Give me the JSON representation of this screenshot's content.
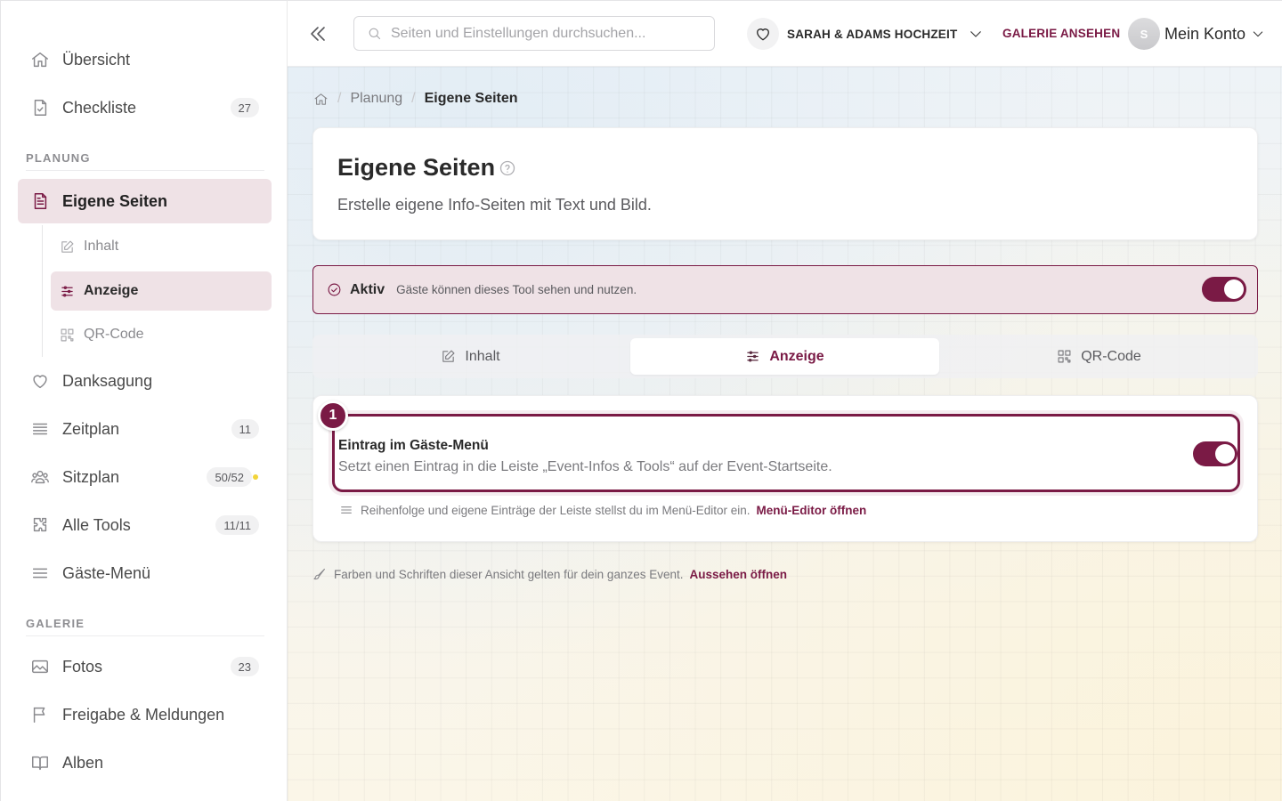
{
  "sidebar": {
    "items_top": [
      {
        "label": "Übersicht"
      },
      {
        "label": "Checkliste",
        "badge": "27"
      }
    ],
    "section_planung": "PLANUNG",
    "active_item": {
      "label": "Eigene Seiten"
    },
    "sub_items": [
      {
        "label": "Inhalt"
      },
      {
        "label": "Anzeige"
      },
      {
        "label": "QR-Code"
      }
    ],
    "items_planung": [
      {
        "label": "Danksagung"
      },
      {
        "label": "Zeitplan",
        "badge": "11"
      },
      {
        "label": "Sitzplan",
        "badge": "50/52"
      },
      {
        "label": "Alle Tools",
        "badge": "11/11"
      },
      {
        "label": "Gäste-Menü"
      }
    ],
    "section_galerie": "GALERIE",
    "items_galerie": [
      {
        "label": "Fotos",
        "badge": "23"
      },
      {
        "label": "Freigabe & Meldungen"
      },
      {
        "label": "Alben"
      }
    ]
  },
  "topbar": {
    "search_placeholder": "Seiten und Einstellungen durchsuchen...",
    "event_name": "SARAH & ADAMS HOCHZEIT",
    "gallery_link": "GALERIE ANSEHEN",
    "avatar_initial": "S",
    "account_label": "Mein Konto"
  },
  "breadcrumb": {
    "items": [
      "Planung",
      "Eigene Seiten"
    ]
  },
  "header": {
    "title": "Eigene Seiten",
    "subtitle": "Erstelle eigene Info-Seiten mit Text und Bild."
  },
  "status": {
    "title": "Aktiv",
    "description": "Gäste können dieses Tool sehen und nutzen.",
    "enabled": true
  },
  "tabs": [
    {
      "label": "Inhalt"
    },
    {
      "label": "Anzeige"
    },
    {
      "label": "QR-Code"
    }
  ],
  "setting": {
    "step": "1",
    "title": "Eintrag im Gäste-Menü",
    "description": "Setzt einen Eintrag in die Leiste „Event-Infos & Tools“ auf der Event-Startseite.",
    "enabled": true,
    "hint": "Reihenfolge und eigene Einträge der Leiste stellst du im Menü-Editor ein.",
    "hint_link": "Menü-Editor öffnen"
  },
  "footer_hint": {
    "text": "Farben und Schriften dieser Ansicht gelten für dein ganzes Event.",
    "link": "Aussehen öffnen"
  },
  "colors": {
    "accent": "#7a1a45",
    "active_bg": "#efe2e6"
  }
}
